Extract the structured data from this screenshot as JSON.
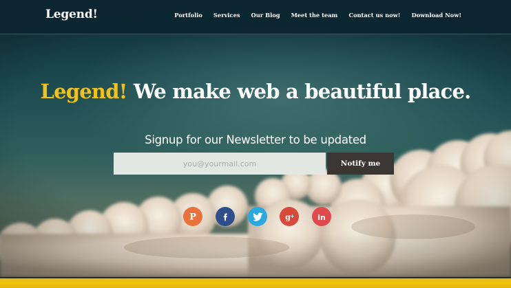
{
  "header": {
    "logo": "Legend!",
    "nav": [
      "Portfolio",
      "Services",
      "Our Blog",
      "Meet the team",
      "Contact us now!",
      "Download Now!"
    ]
  },
  "hero": {
    "headline_brand": "Legend!",
    "headline_text": "We make web a beautiful place.",
    "subtitle": "Signup for our Newsletter to be updated",
    "email_placeholder": "you@yourmail.com",
    "notify_label": "Notify me"
  },
  "social": [
    {
      "name": "pinterest-icon",
      "color": "#e8713c"
    },
    {
      "name": "facebook-icon",
      "color": "#2f4f8c"
    },
    {
      "name": "twitter-icon",
      "color": "#28a9e0"
    },
    {
      "name": "google-plus-icon",
      "color": "#d9493a"
    },
    {
      "name": "linkedin-icon",
      "color": "#e04a4e"
    }
  ],
  "colors": {
    "accent": "#f3c11b",
    "navbar": "#0c2530",
    "button": "#3a3633"
  }
}
